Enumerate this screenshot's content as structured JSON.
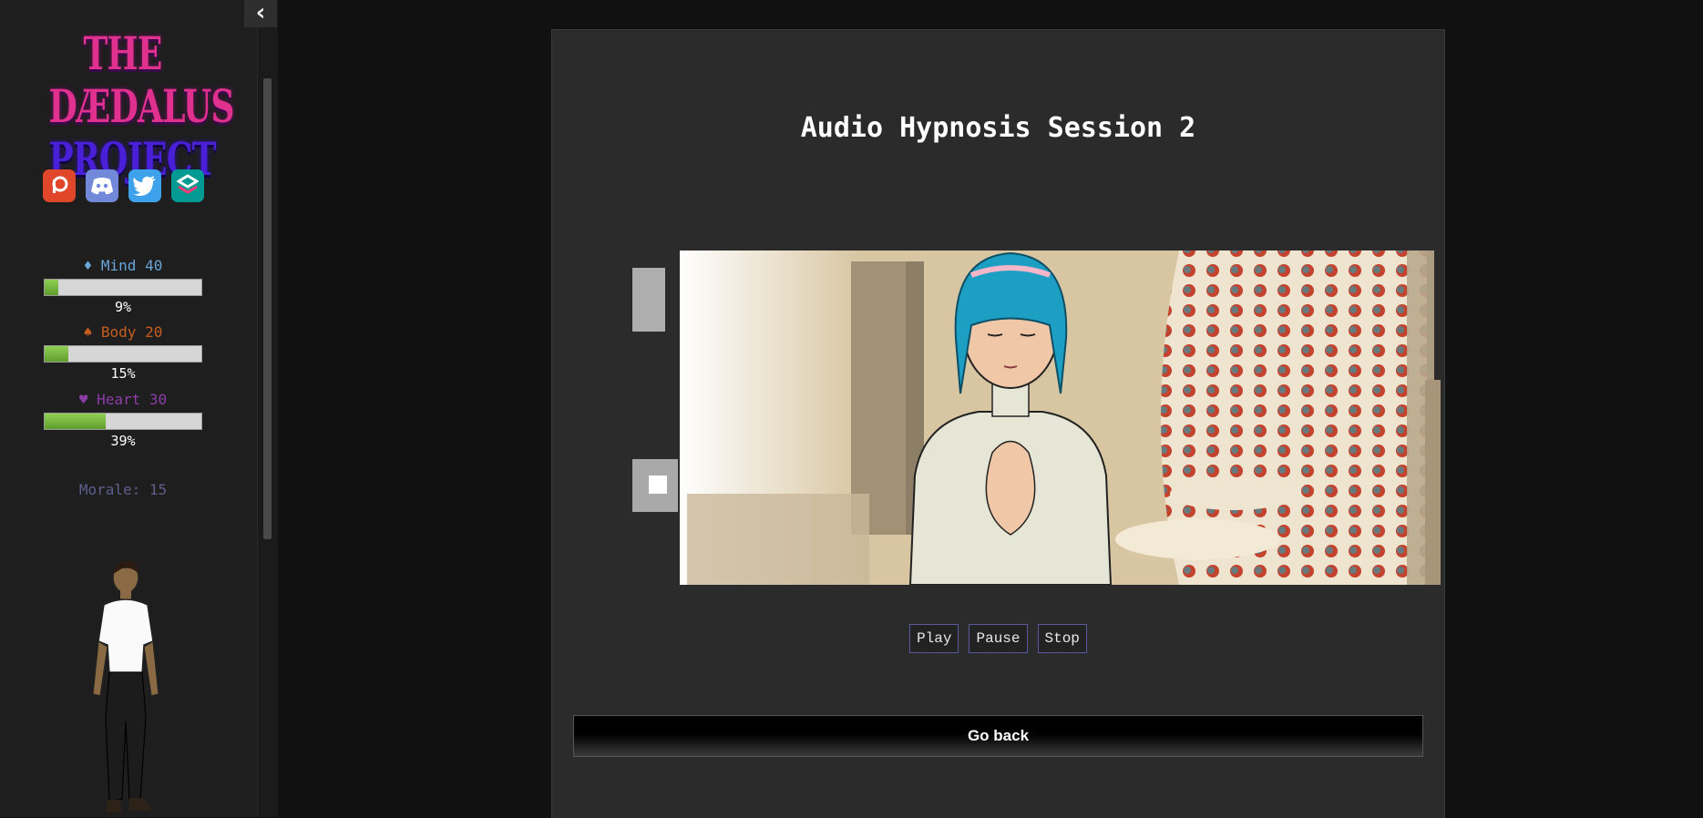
{
  "sidebar": {
    "collapse_icon": "chevron-left-icon",
    "logo": {
      "line1": "THE DÆDALUS",
      "line2": "PROJECT"
    },
    "socials": [
      {
        "name": "patreon-icon",
        "color": "#e0472a"
      },
      {
        "name": "discord-icon",
        "color": "#7289da"
      },
      {
        "name": "twitter-icon",
        "color": "#3ea1ec"
      },
      {
        "name": "subscribestar-icon",
        "color": "#009a92"
      }
    ],
    "stats": [
      {
        "label": "♦ Mind 40",
        "percent": "9%",
        "fill": 0.09,
        "color": "#6aa6d8"
      },
      {
        "label": "♠ Body 20",
        "percent": "15%",
        "fill": 0.15,
        "color": "#c85e1e"
      },
      {
        "label": "♥ Heart 30",
        "percent": "39%",
        "fill": 0.39,
        "color": "#8a3ea8"
      }
    ],
    "morale": "Morale: 15"
  },
  "main": {
    "title": "Audio Hypnosis Session 2",
    "controls": {
      "play": "Play",
      "pause": "Pause",
      "stop": "Stop"
    },
    "go_back": "Go back"
  }
}
